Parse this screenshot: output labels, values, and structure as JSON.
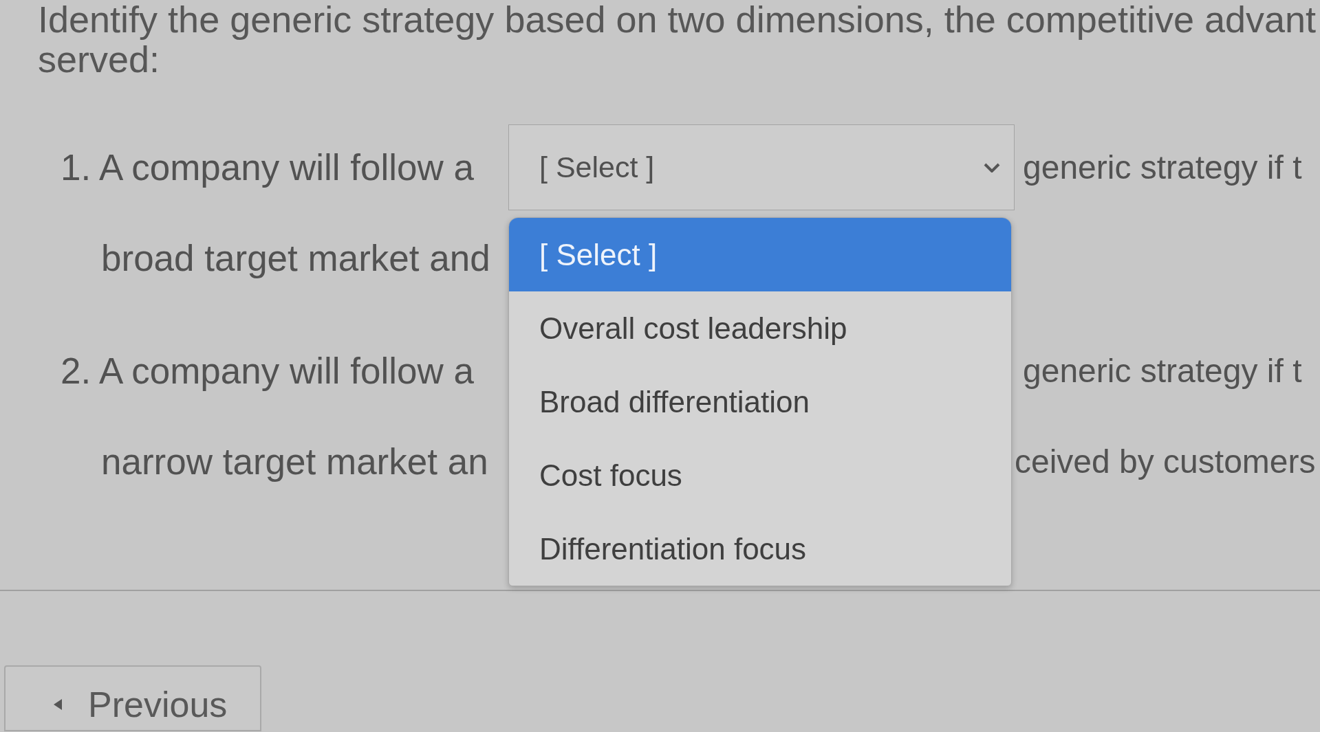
{
  "instructions": {
    "lines": [
      "Identify the generic strategy based on two dimensions, the competitive advant",
      "served:"
    ]
  },
  "questions": [
    {
      "lead": "1. A company will follow a",
      "dropdown": {
        "value": "[ Select ]",
        "expanded": true,
        "options": [
          {
            "label": "[ Select ]",
            "selected": true
          },
          {
            "label": "Overall cost leadership",
            "selected": false
          },
          {
            "label": "Broad differentiation",
            "selected": false
          },
          {
            "label": "Cost focus",
            "selected": false
          },
          {
            "label": "Differentiation focus",
            "selected": false
          }
        ]
      },
      "trail": "generic strategy if t",
      "continuation": [
        "broad target market and"
      ]
    },
    {
      "lead": "2. A company will follow a",
      "trail": "generic strategy if t",
      "continuation": [
        "narrow target market an",
        "ceived by customers"
      ]
    }
  ],
  "navigation": {
    "previous_button": {
      "label": "Previous"
    }
  }
}
